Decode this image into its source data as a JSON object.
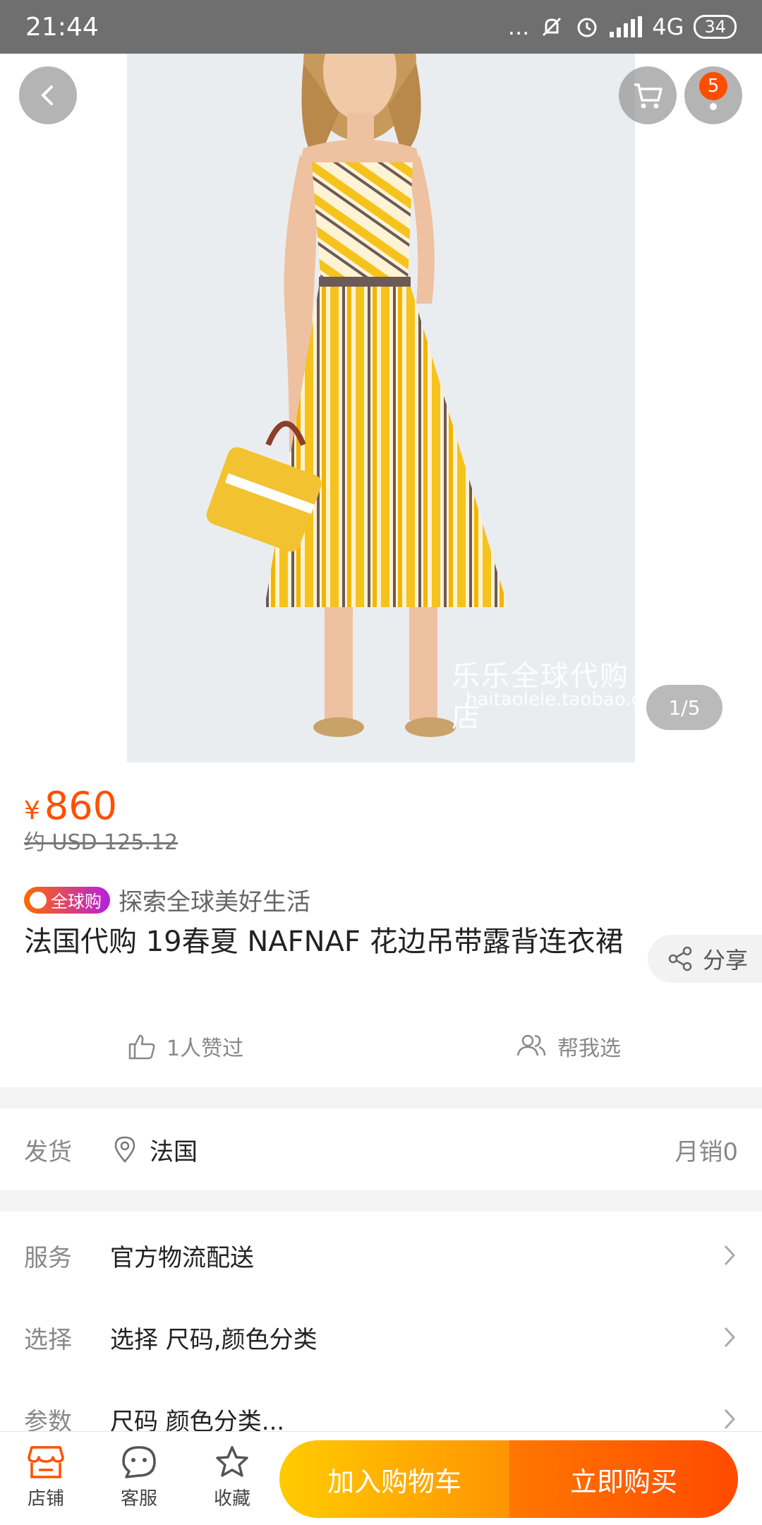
{
  "status_bar": {
    "time": "21:44",
    "dots": "...",
    "network": "4G",
    "battery": "34"
  },
  "photo": {
    "watermark_cn": "乐乐全球代购店",
    "watermark_url": "haitaolele.taobao.com",
    "pager": "1/5"
  },
  "header": {
    "cart_badge": "5"
  },
  "price": {
    "currency": "¥",
    "value": "860",
    "usd": "约 USD 125.12"
  },
  "global_tag": {
    "badge": "全球购",
    "text": "探索全球美好生活"
  },
  "product": {
    "title": "法国代购 19春夏 NAFNAF 花边吊带露背连衣裙",
    "share": "分享",
    "likes": "1人赞过",
    "help_choose": "帮我选"
  },
  "shipping": {
    "label": "发货",
    "location": "法国",
    "monthly_sales": "月销0"
  },
  "rows": {
    "service_label": "服务",
    "service_value": "官方物流配送",
    "select_label": "选择",
    "select_value": "选择 尺码,颜色分类",
    "params_label": "参数",
    "params_value": "尺码 颜色分类..."
  },
  "bottom_bar": {
    "shop": "店铺",
    "service": "客服",
    "favorite": "收藏",
    "add_cart": "加入购物车",
    "buy_now": "立即购买"
  },
  "colors": {
    "accent": "#ff5000",
    "cart_btn": "#ffb400",
    "buy_btn": "#ff5a00"
  }
}
